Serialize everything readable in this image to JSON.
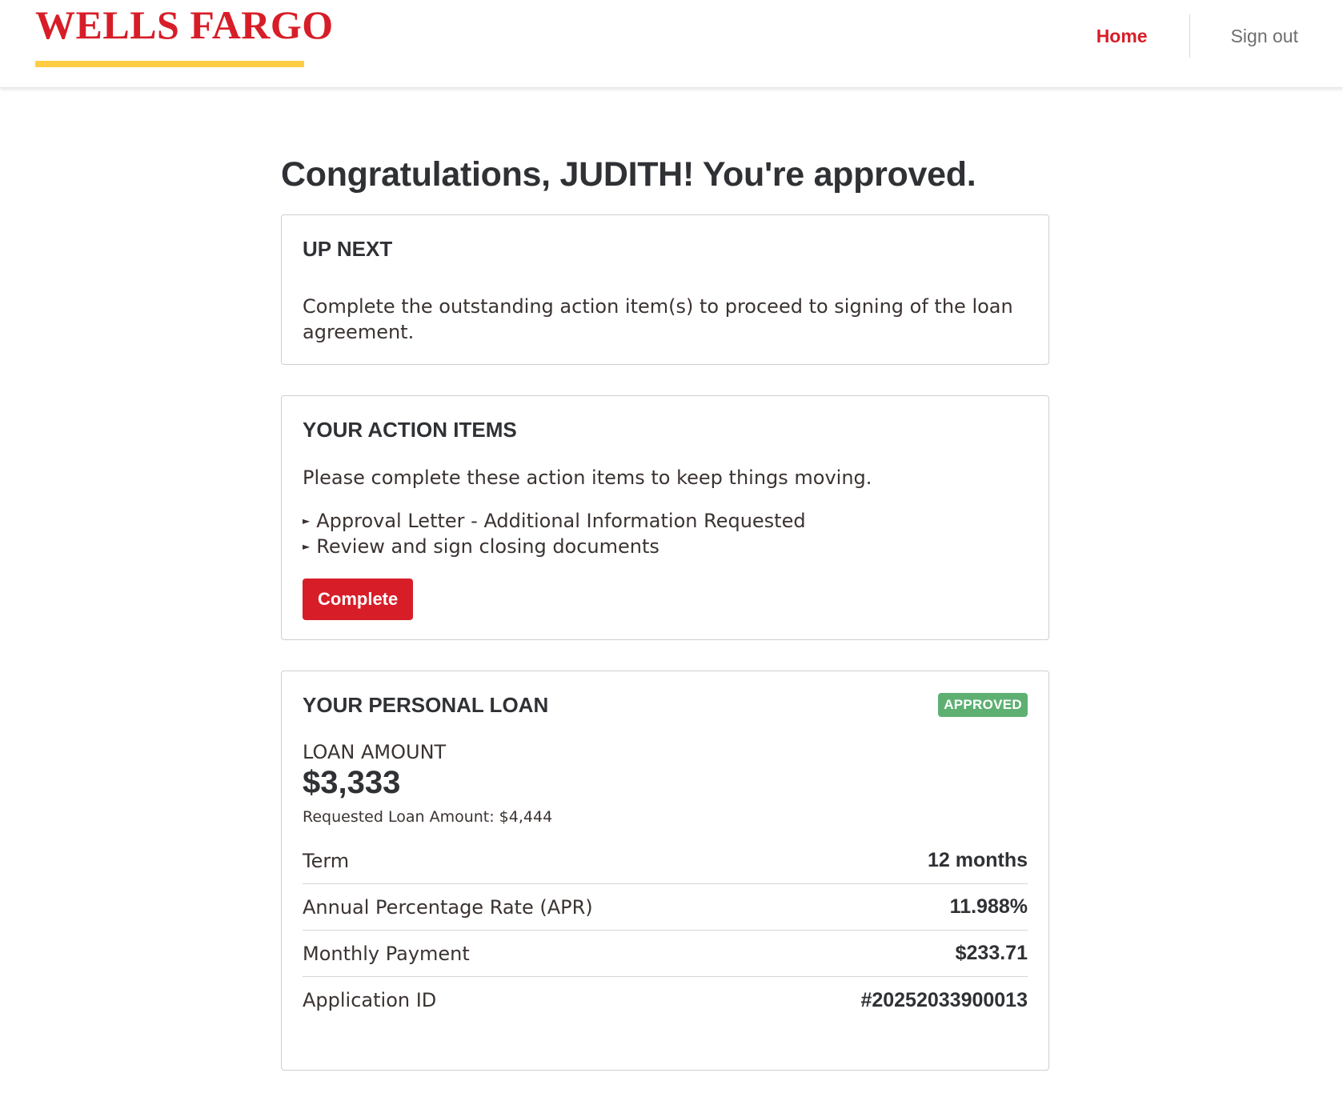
{
  "header": {
    "logo_text": "WELLS FARGO",
    "nav": {
      "home_label": "Home",
      "signout_label": "Sign out"
    }
  },
  "main": {
    "title": "Congratulations, JUDITH! You're approved.",
    "up_next": {
      "heading": "UP NEXT",
      "text": "Complete the outstanding action item(s) to proceed to signing of the loan agreement."
    },
    "action_items": {
      "heading": "YOUR ACTION ITEMS",
      "intro": "Please complete these action items to keep things moving.",
      "items": [
        "Approval Letter - Additional Information Requested",
        "Review and sign closing documents"
      ],
      "button_label": "Complete"
    },
    "personal_loan": {
      "heading": "YOUR PERSONAL LOAN",
      "status_badge": "APPROVED",
      "amount_label": "LOAN AMOUNT",
      "amount_value": "$3,333",
      "requested_text": "Requested Loan Amount: $4,444",
      "details": [
        {
          "label": "Term",
          "value": "12 months"
        },
        {
          "label": "Annual Percentage Rate (APR)",
          "value": "11.988%"
        },
        {
          "label": "Monthly Payment",
          "value": "$233.71"
        },
        {
          "label": "Application ID",
          "value": "#20252033900013"
        }
      ]
    }
  },
  "colors": {
    "brand_red": "#d71e28",
    "brand_gold": "#ffcd41",
    "approved_green": "#5db072"
  }
}
